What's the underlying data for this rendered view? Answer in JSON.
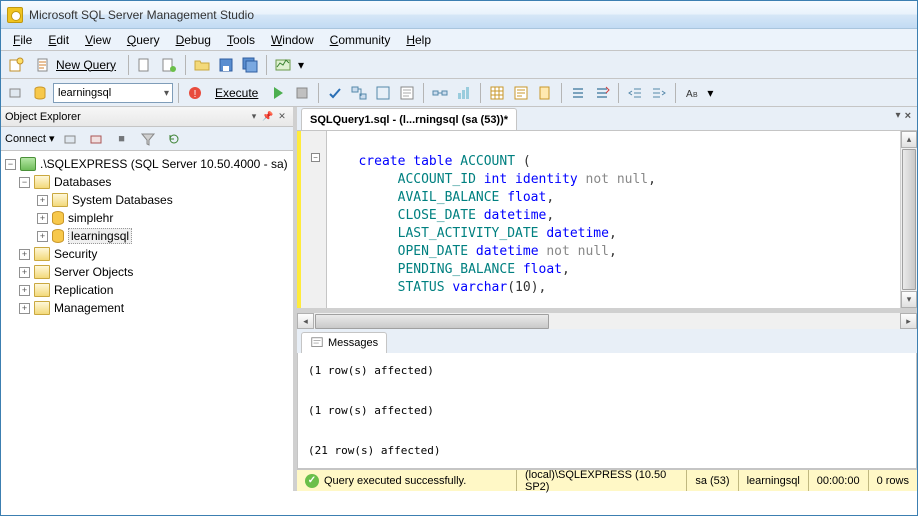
{
  "title": "Microsoft SQL Server Management Studio",
  "menu": {
    "file": "File",
    "edit": "Edit",
    "view": "View",
    "query": "Query",
    "debug": "Debug",
    "tools": "Tools",
    "window": "Window",
    "community": "Community",
    "help": "Help"
  },
  "toolbar": {
    "new_query": "New Query",
    "db_selected": "learningsql",
    "execute": "Execute"
  },
  "object_explorer": {
    "title": "Object Explorer",
    "connect": "Connect",
    "server": ".\\SQLEXPRESS (SQL Server 10.50.4000 - sa)",
    "folders": {
      "databases": "Databases",
      "system_db": "System Databases",
      "db1": "simplehr",
      "db2": "learningsql",
      "security": "Security",
      "server_objects": "Server Objects",
      "replication": "Replication",
      "management": "Management"
    }
  },
  "editor": {
    "tab_title": "SQLQuery1.sql - (l...rningsql (sa (53))*",
    "code_lines": [
      "",
      "create table ACCOUNT (",
      "     ACCOUNT_ID int identity not null,",
      "     AVAIL_BALANCE float,",
      "     CLOSE_DATE datetime,",
      "     LAST_ACTIVITY_DATE datetime,",
      "     OPEN_DATE datetime not null,",
      "     PENDING_BALANCE float,",
      "     STATUS varchar(10),"
    ]
  },
  "messages": {
    "tab": "Messages",
    "lines": [
      "(1 row(s) affected)",
      "(1 row(s) affected)",
      "(21 row(s) affected)"
    ]
  },
  "status": {
    "text": "Query executed successfully.",
    "server": "(local)\\SQLEXPRESS (10.50 SP2)",
    "user": "sa (53)",
    "db": "learningsql",
    "time": "00:00:00",
    "rows": "0 rows"
  }
}
